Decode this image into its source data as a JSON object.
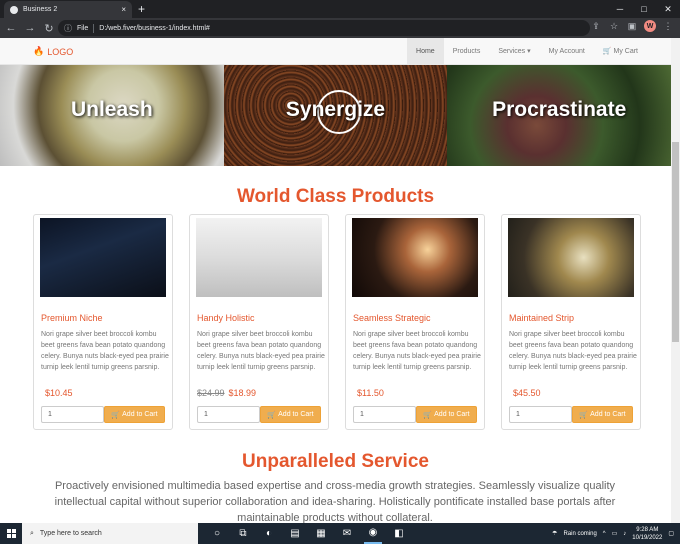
{
  "browser": {
    "tab_title": "Business 2",
    "tab_close": "×",
    "new_tab": "+",
    "file_label": "File",
    "url": "D:/web.fiver/business-1/index.html#",
    "profile_initial": "W"
  },
  "site": {
    "logo": "LOGO",
    "nav": [
      "Home",
      "Products",
      "Services ▾",
      "My Account",
      "My Cart"
    ],
    "hero": [
      "Unleash",
      "Synergize",
      "Procrastinate"
    ],
    "products_heading": "World Class Products",
    "products": [
      {
        "name": "Premium Niche",
        "desc": "Nori grape silver beet broccoli kombu beet greens fava bean potato quandong celery. Bunya nuts black-eyed pea prairie turnip leek lentil turnip greens parsnip.",
        "price": "$10.45",
        "old_price": "",
        "qty": "1",
        "button": "Add to Cart"
      },
      {
        "name": "Handy Holistic",
        "desc": "Nori grape silver beet broccoli kombu beet greens fava bean potato quandong celery. Bunya nuts black-eyed pea prairie turnip leek lentil turnip greens parsnip.",
        "price": "$18.99",
        "old_price": "$24.99",
        "qty": "1",
        "button": "Add to Cart"
      },
      {
        "name": "Seamless Strategic",
        "desc": "Nori grape silver beet broccoli kombu beet greens fava bean potato quandong celery. Bunya nuts black-eyed pea prairie turnip leek lentil turnip greens parsnip.",
        "price": "$11.50",
        "old_price": "",
        "qty": "1",
        "button": "Add to Cart"
      },
      {
        "name": "Maintained Strip",
        "desc": "Nori grape silver beet broccoli kombu beet greens fava bean potato quandong celery. Bunya nuts black-eyed pea prairie turnip leek lentil turnip greens parsnip.",
        "price": "$45.50",
        "old_price": "",
        "qty": "1",
        "button": "Add to Cart"
      }
    ],
    "service_heading": "Unparalleled Service",
    "service_text": "Proactively envisioned multimedia based expertise and cross-media growth strategies. Seamlessly visualize quality intellectual capital without superior collaboration and idea-sharing. Holistically pontificate installed base portals after maintainable products without collateral."
  },
  "taskbar": {
    "search_placeholder": "Type here to search",
    "weather": "Rain coming",
    "time": "9:28 AM",
    "date": "10/19/2022"
  }
}
